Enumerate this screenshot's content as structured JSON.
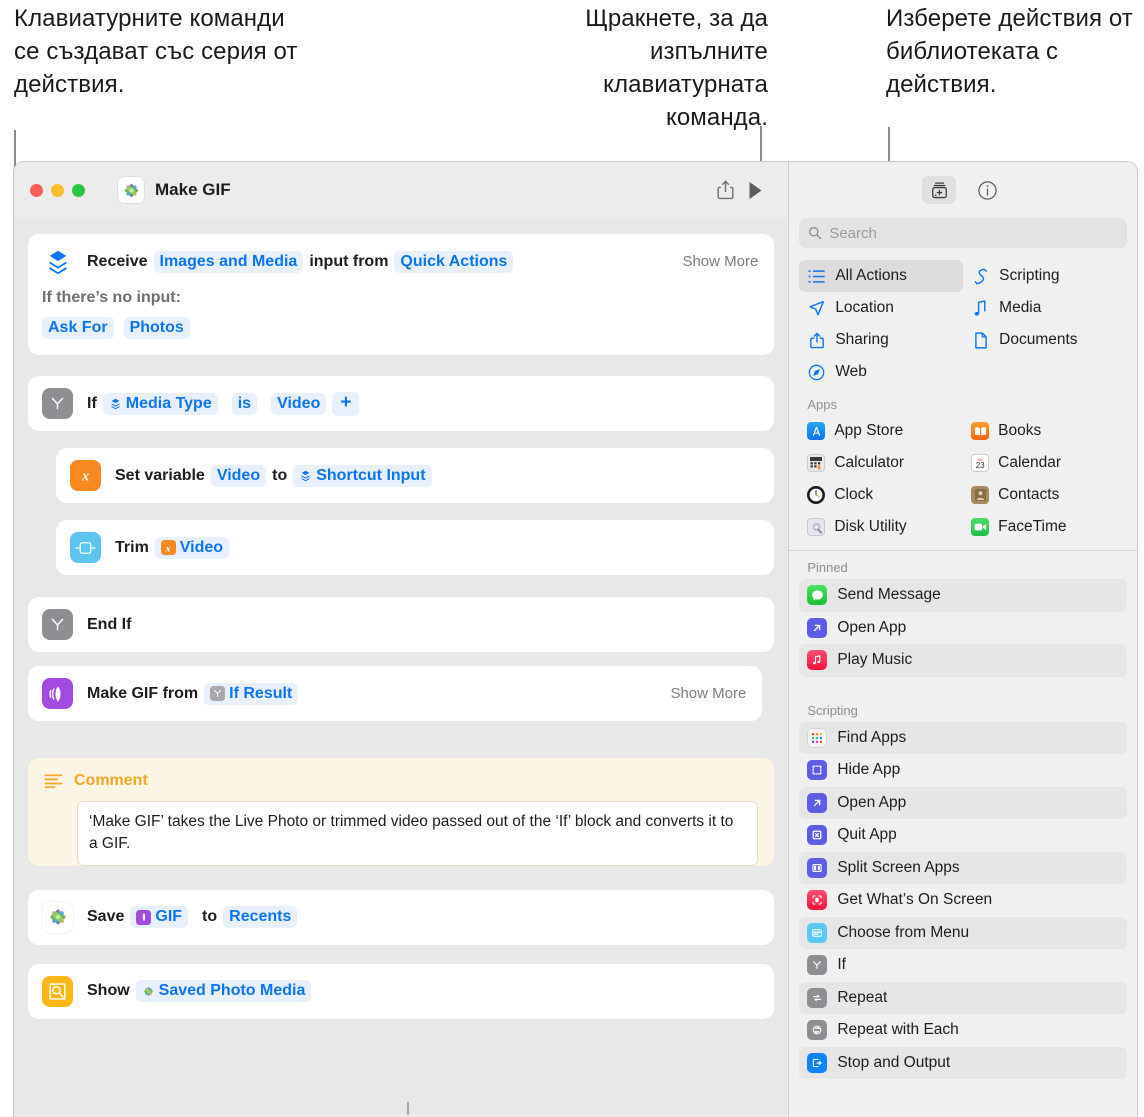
{
  "callouts": {
    "left": "Клавиатурните команди се създават със серия от действия.",
    "middle": "Щракнете, за да изпълните клавиатурната команда.",
    "right": "Изберете действия от библиотеката с действия."
  },
  "window": {
    "title": "Make GIF",
    "app_icon": "photos-icon",
    "traffic_lights": [
      "close-button",
      "minimize-button",
      "zoom-button"
    ],
    "toolbar": {
      "share_label": "share-icon",
      "run_label": "run-icon"
    }
  },
  "actions": [
    {
      "id": "receive",
      "icon": "receive-input-icon",
      "label": "Receive",
      "tokens": [
        "Images and Media"
      ],
      "mid_label": "input from",
      "tokens2": [
        "Quick Actions"
      ],
      "show_more": "Show More",
      "sub_label": "If there’s no input:",
      "pills": [
        "Ask For",
        "Photos"
      ]
    },
    {
      "id": "if",
      "icon": "if-icon",
      "label": "If",
      "tokens": [
        "Media Type"
      ],
      "mid_label": "is",
      "tokens2": [
        "Video"
      ],
      "plus": "+"
    },
    {
      "id": "set-variable",
      "icon": "variable-icon",
      "label": "Set variable",
      "tokens": [
        "Video"
      ],
      "mid_label": "to",
      "tokens2": [
        "Shortcut Input"
      ]
    },
    {
      "id": "trim",
      "icon": "trim-icon",
      "label": "Trim",
      "tokens": [
        "Video"
      ]
    },
    {
      "id": "end-if",
      "icon": "if-icon",
      "label": "End If"
    },
    {
      "id": "make-gif",
      "icon": "make-gif-icon",
      "label": "Make GIF from",
      "tokens": [
        "If Result"
      ],
      "show_more": "Show More"
    }
  ],
  "comment": {
    "icon": "comment-lines-icon",
    "title": "Comment",
    "text": "‘Make GIF’ takes the Live Photo or trimmed video passed out of the ‘If’ block and converts it to a GIF."
  },
  "actions_tail": [
    {
      "id": "save",
      "icon": "photos-icon",
      "label": "Save",
      "tokens": [
        "GIF"
      ],
      "mid_label": "to",
      "tokens2": [
        "Recents"
      ]
    },
    {
      "id": "show",
      "icon": "quick-look-icon",
      "label": "Show",
      "tokens": [
        "Saved Photo Media"
      ]
    }
  ],
  "sidebar": {
    "toolbar": {
      "library_button": "action-library-icon",
      "info_button": "info-icon"
    },
    "search": {
      "placeholder": "Search",
      "value": "",
      "icon": "search-icon"
    },
    "categories": [
      {
        "label": "All Actions",
        "icon": "list-icon",
        "selected": true,
        "color": "#0b76ef"
      },
      {
        "label": "Scripting",
        "icon": "scripting-icon",
        "selected": false,
        "color": "#0b76ef"
      },
      {
        "label": "Location",
        "icon": "location-icon",
        "selected": false,
        "color": "#0b76ef"
      },
      {
        "label": "Media",
        "icon": "music-note-icon",
        "selected": false,
        "color": "#0b76ef"
      },
      {
        "label": "Sharing",
        "icon": "share-icon",
        "selected": false,
        "color": "#0b76ef"
      },
      {
        "label": "Documents",
        "icon": "document-icon",
        "selected": false,
        "color": "#0b76ef"
      },
      {
        "label": "Web",
        "icon": "safari-icon",
        "selected": false,
        "color": "#0b76ef"
      }
    ],
    "apps_header": "Apps",
    "apps": [
      {
        "label": "App Store",
        "icon": "app-store-icon",
        "color": "#1b8cf3"
      },
      {
        "label": "Books",
        "icon": "books-icon",
        "color": "#f4620f"
      },
      {
        "label": "Calculator",
        "icon": "calculator-icon",
        "color": "#3c3c3c"
      },
      {
        "label": "Calendar",
        "icon": "calendar-icon",
        "color": "#ffffff"
      },
      {
        "label": "Clock",
        "icon": "clock-icon",
        "color": "#1c1c1e"
      },
      {
        "label": "Contacts",
        "icon": "contacts-icon",
        "color": "#9a7b4f"
      },
      {
        "label": "Disk Utility",
        "icon": "disk-utility-icon",
        "color": "#dcdce2"
      },
      {
        "label": "FaceTime",
        "icon": "facetime-icon",
        "color": "#31cf55"
      }
    ],
    "pinned_header": "Pinned",
    "pinned": [
      {
        "label": "Send Message",
        "icon": "messages-icon",
        "color": "#2fc84a"
      },
      {
        "label": "Open App",
        "icon": "open-app-icon",
        "color": "#5c5ce6"
      },
      {
        "label": "Play Music",
        "icon": "music-icon",
        "color": "#fa2c55"
      }
    ],
    "scripting_header": "Scripting",
    "scripting": [
      {
        "label": "Find Apps",
        "icon": "find-apps-icon",
        "color": "#f2f2f2"
      },
      {
        "label": "Hide App",
        "icon": "hide-app-icon",
        "color": "#5c5ce6"
      },
      {
        "label": "Open App",
        "icon": "open-app-icon",
        "color": "#5c5ce6"
      },
      {
        "label": "Quit App",
        "icon": "quit-app-icon",
        "color": "#5c5ce6"
      },
      {
        "label": "Split Screen Apps",
        "icon": "split-screen-icon",
        "color": "#5c5ce6"
      },
      {
        "label": "Get What’s On Screen",
        "icon": "on-screen-icon",
        "color": "#fa2c55"
      },
      {
        "label": "Choose from Menu",
        "icon": "menu-icon",
        "color": "#5ac8f5"
      },
      {
        "label": "If",
        "icon": "if-icon",
        "color": "#8e8e93"
      },
      {
        "label": "Repeat",
        "icon": "repeat-icon",
        "color": "#8e8e93"
      },
      {
        "label": "Repeat with Each",
        "icon": "repeat-each-icon",
        "color": "#8e8e93"
      },
      {
        "label": "Stop and Output",
        "icon": "stop-output-icon",
        "color": "#0b84ff"
      }
    ]
  },
  "colors": {
    "accent_blue": "#0b76ef",
    "token_bg": "#e8f0fe",
    "comment_yellow": "#f5a623",
    "comment_bg": "#fdf5e3",
    "window_bg": "#ececec",
    "sidebar_bg": "#f0f0f0"
  }
}
